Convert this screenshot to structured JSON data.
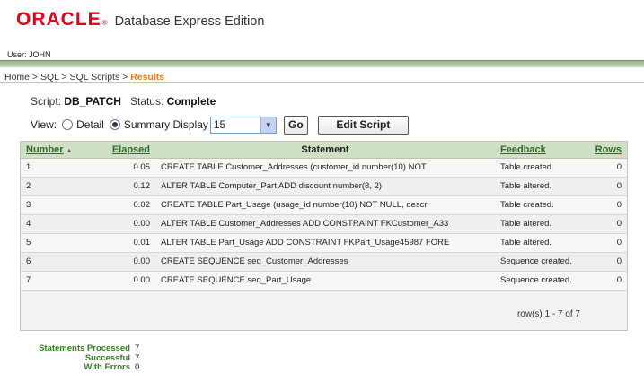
{
  "header": {
    "brand": "ORACLE",
    "brand_mark": "®",
    "product": "Database Express Edition",
    "user_label": "User: JOHN"
  },
  "breadcrumb": {
    "items": [
      "Home",
      "SQL",
      "SQL Scripts"
    ],
    "separator": " > ",
    "current": "Results"
  },
  "script": {
    "script_label": "Script:",
    "script_name": "DB_PATCH",
    "status_label": "Status:",
    "status_value": "Complete"
  },
  "view": {
    "label": "View:",
    "option_detail": "Detail",
    "option_summary": "Summary",
    "selected": "Summary",
    "display_label": "Display",
    "display_value": "15",
    "go_label": "Go",
    "edit_label": "Edit Script"
  },
  "table": {
    "headers": {
      "number": "Number",
      "elapsed": "Elapsed",
      "statement": "Statement",
      "feedback": "Feedback",
      "rows": "Rows"
    },
    "sort_indicator": "▲",
    "rows": [
      {
        "number": "1",
        "elapsed": "0.05",
        "statement": "CREATE TABLE Customer_Addresses (customer_id number(10) NOT",
        "feedback": "Table created.",
        "rows": "0"
      },
      {
        "number": "2",
        "elapsed": "0.12",
        "statement": "ALTER TABLE Computer_Part ADD discount number(8, 2)",
        "feedback": "Table altered.",
        "rows": "0"
      },
      {
        "number": "3",
        "elapsed": "0.02",
        "statement": "CREATE TABLE Part_Usage (usage_id number(10) NOT NULL, descr",
        "feedback": "Table created.",
        "rows": "0"
      },
      {
        "number": "4",
        "elapsed": "0.00",
        "statement": "ALTER TABLE Customer_Addresses ADD CONSTRAINT FKCustomer_A33",
        "feedback": "Table altered.",
        "rows": "0"
      },
      {
        "number": "5",
        "elapsed": "0.01",
        "statement": "ALTER TABLE Part_Usage ADD CONSTRAINT FKPart_Usage45987 FORE",
        "feedback": "Table altered.",
        "rows": "0"
      },
      {
        "number": "6",
        "elapsed": "0.00",
        "statement": "CREATE SEQUENCE seq_Customer_Addresses",
        "feedback": "Sequence created.",
        "rows": "0"
      },
      {
        "number": "7",
        "elapsed": "0.00",
        "statement": "CREATE SEQUENCE seq_Part_Usage",
        "feedback": "Sequence created.",
        "rows": "0"
      }
    ],
    "pager": "row(s) 1 - 7 of 7"
  },
  "summary": {
    "processed_label": "Statements Processed",
    "processed_value": "7",
    "successful_label": "Successful",
    "successful_value": "7",
    "errors_label": "With Errors",
    "errors_value": "0"
  }
}
